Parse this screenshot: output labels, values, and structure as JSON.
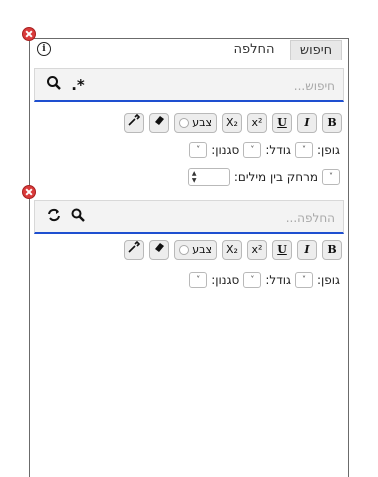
{
  "find_panel": {
    "tabs": {
      "find": "חיפוש",
      "replace": "החלפה"
    },
    "search": {
      "placeholder": "חיפוש...",
      "regex_icon": ".*",
      "search_icon": "search"
    },
    "format": {
      "bold": "B",
      "italic": "I",
      "underline": "U",
      "superscript": "x²",
      "subscript": "X₂",
      "color": "צבע",
      "font_label": "גופן:",
      "size_label": "גודל:",
      "style_label": "סגנון:",
      "word_spacing_label": "מרחק בין מילים:"
    }
  },
  "replace_panel": {
    "replace": {
      "placeholder": "החלפה...",
      "replace_icon": "replace",
      "replace_all_icon": "replace-all"
    },
    "format": {
      "bold": "B",
      "italic": "I",
      "underline": "U",
      "superscript": "x²",
      "subscript": "X₂",
      "color": "צבע",
      "font_label": "גופן:",
      "size_label": "גודל:",
      "style_label": "סגנון:"
    }
  },
  "dropdown_glyph": "˅",
  "colors": {
    "accent": "#1e4fd0",
    "close": "#d93b3b"
  }
}
